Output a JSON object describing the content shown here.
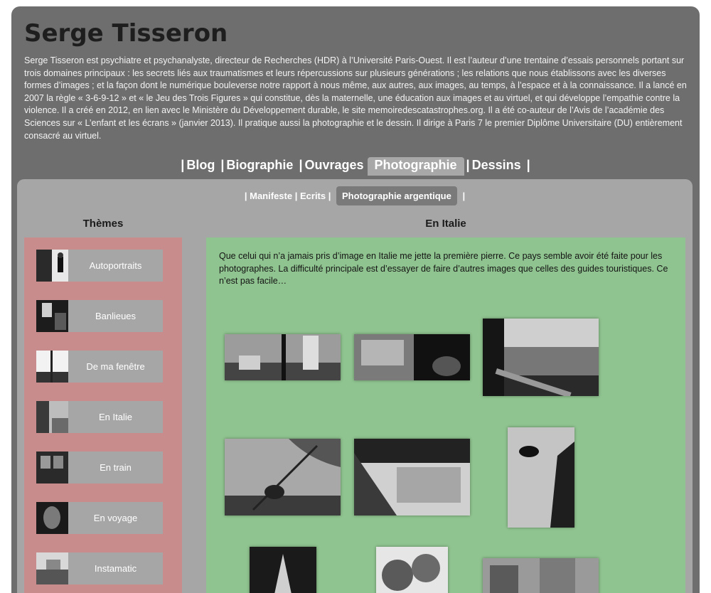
{
  "site": {
    "title": "Serge Tisseron",
    "bio": "Serge Tisseron est psychiatre et psychanalyste, directeur de Recherches (HDR) à l’Université Paris-Ouest. Il est l’auteur d’une trentaine d’essais personnels portant sur trois domaines principaux : les secrets liés aux traumatismes et leurs répercussions sur plusieurs générations ; les relations que nous établissons avec les diverses formes d’images ; et la façon dont le numérique bouleverse notre rapport à nous même, aux autres, aux images, au temps, à l’espace et à la connaissance. Il a lancé en 2007 la règle « 3-6-9-12 » et « le Jeu des Trois Figures » qui constitue, dès la maternelle, une éducation aux images et au virtuel, et qui développe l’empathie contre la violence. Il a créé en 2012, en lien avec le Ministère du Développement durable, le site memoiredescatastrophes.org. Il a été co-auteur de l’Avis de l’académie des Sciences sur « L’enfant et les écrans » (janvier 2013). Il pratique aussi la photographie et le dessin. Il dirige à Paris 7 le premier Diplôme Universitaire (DU) entièrement consacré au virtuel."
  },
  "mainnav": {
    "blog": "Blog",
    "biographie": "Biographie",
    "ouvrages": "Ouvrages",
    "photographie": "Photographie",
    "dessins": "Dessins",
    "sep": "|"
  },
  "subnav": {
    "manifeste": "Manifeste",
    "ecrits": "Ecrits",
    "argentique": "Photographie argentique",
    "sep": "|"
  },
  "themes": {
    "heading": "Thèmes",
    "items": [
      {
        "label": "Autoportraits"
      },
      {
        "label": "Banlieues"
      },
      {
        "label": "De ma fenêtre"
      },
      {
        "label": "En Italie"
      },
      {
        "label": "En train"
      },
      {
        "label": "En voyage"
      },
      {
        "label": "Instamatic"
      }
    ]
  },
  "gallery": {
    "heading": "En Italie",
    "intro": "Que celui qui n’a jamais pris d’image en Italie me jette la première pierre. Ce pays semble avoir été faite pour les photographes. La difficulté principale est d’essayer de faire d’autres images que celles des guides touristiques. Ce n’est pas facile…"
  },
  "colors": {
    "outer_bg": "#6e6e6e",
    "inner_bg": "#a6a6a6",
    "themes_bg": "#c88c8c",
    "content_bg": "#8fc38f"
  }
}
